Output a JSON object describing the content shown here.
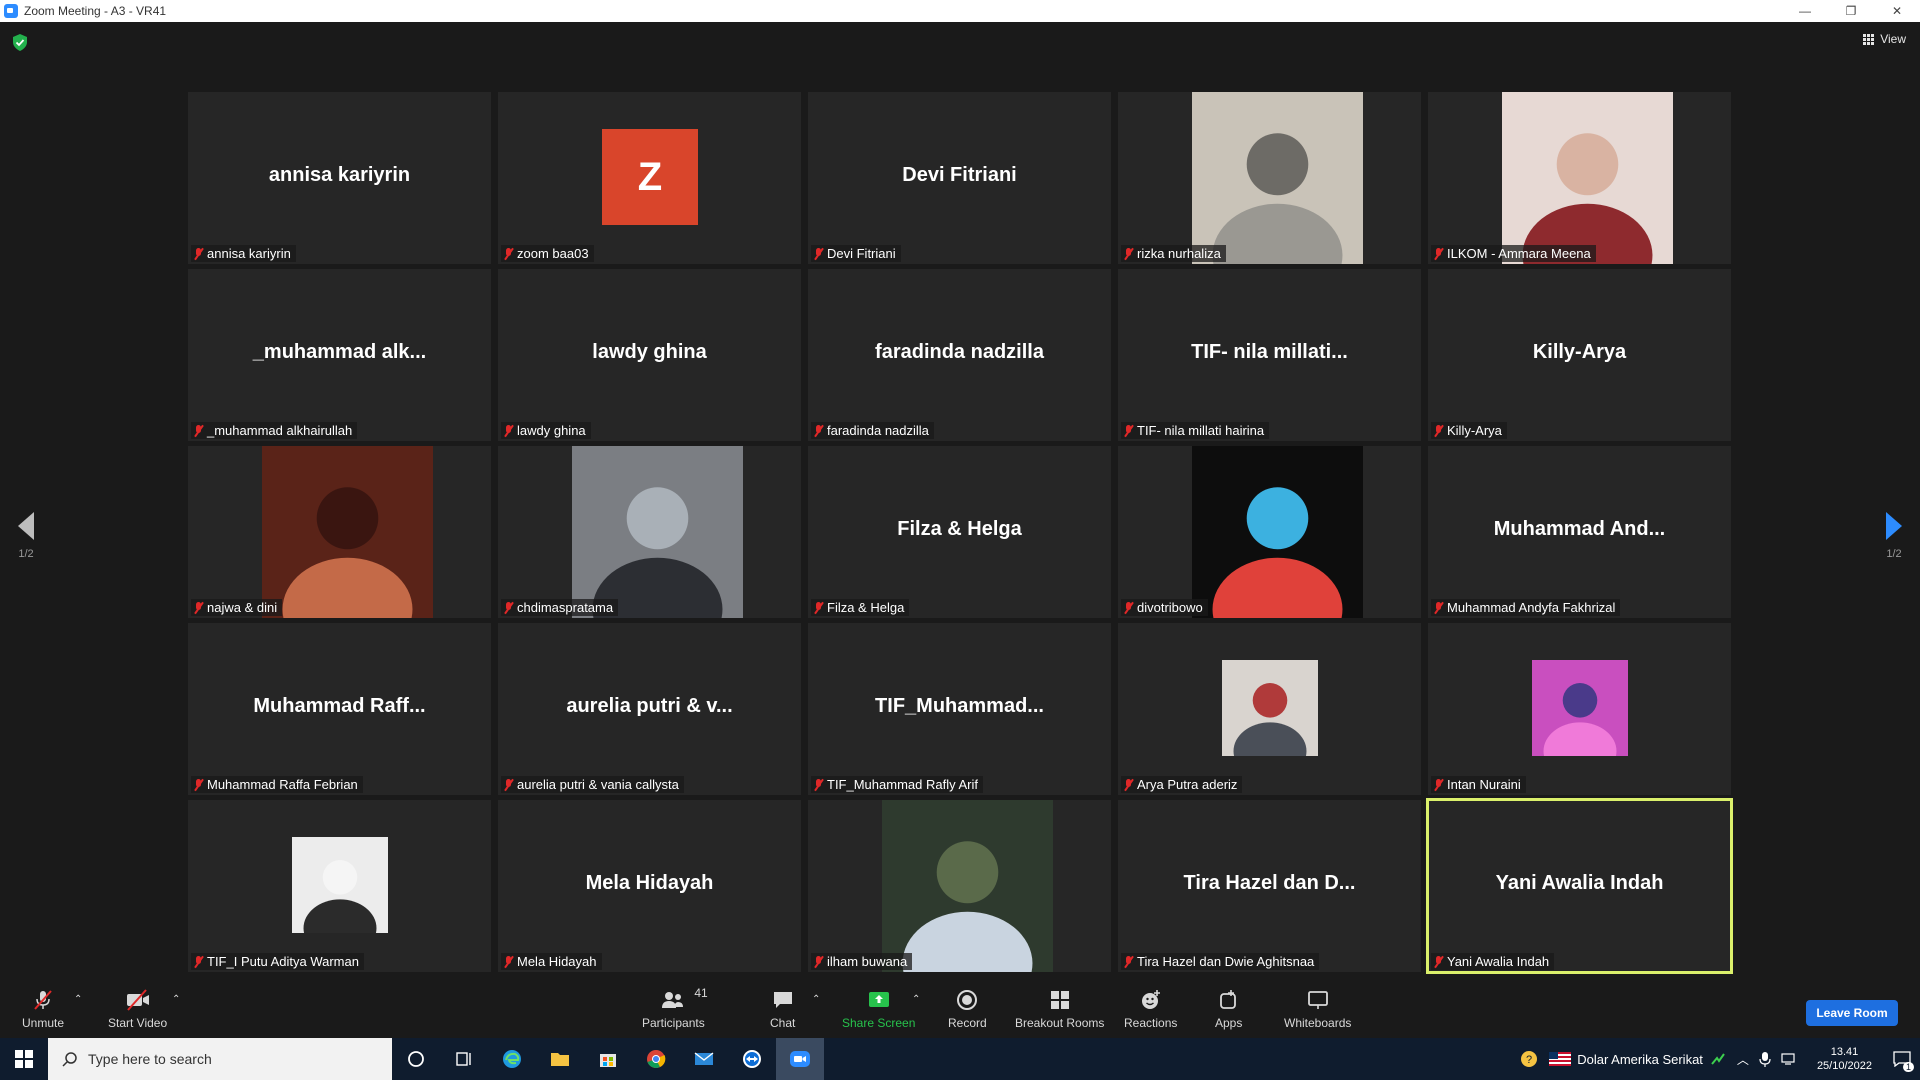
{
  "window": {
    "title": "Zoom Meeting - A3 - VR41",
    "minimize": "—",
    "maximize": "❐",
    "close": "✕"
  },
  "meeting": {
    "view_label": "View",
    "page_indicator_left": "1/2",
    "page_indicator_right": "1/2"
  },
  "participants": [
    {
      "display": "annisa kariyrin",
      "label": "annisa kariyrin",
      "kind": "name"
    },
    {
      "display": "Z",
      "label": "zoom baa03",
      "kind": "avatar"
    },
    {
      "display": "Devi Fitriani",
      "label": "Devi Fitriani",
      "kind": "name"
    },
    {
      "display": "",
      "label": "rizka nurhaliza",
      "kind": "video"
    },
    {
      "display": "",
      "label": "ILKOM - Ammara Meena",
      "kind": "video"
    },
    {
      "display": "_muhammad  alk...",
      "label": "_muhammad alkhairullah",
      "kind": "name"
    },
    {
      "display": "lawdy ghina",
      "label": "lawdy ghina",
      "kind": "name"
    },
    {
      "display": "faradinda nadzilla",
      "label": "faradinda nadzilla",
      "kind": "name"
    },
    {
      "display": "TIF- nila  millati...",
      "label": "TIF- nila millati hairina",
      "kind": "name"
    },
    {
      "display": "Killy-Arya",
      "label": "Killy-Arya",
      "kind": "name"
    },
    {
      "display": "",
      "label": "najwa & dini",
      "kind": "video"
    },
    {
      "display": "",
      "label": "chdimaspratama",
      "kind": "video"
    },
    {
      "display": "Filza & Helga",
      "label": "Filza & Helga",
      "kind": "name"
    },
    {
      "display": "",
      "label": "divotribowo",
      "kind": "video"
    },
    {
      "display": "Muhammad  And...",
      "label": "Muhammad Andyfa Fakhrizal",
      "kind": "name"
    },
    {
      "display": "Muhammad  Raff...",
      "label": "Muhammad Raffa Febrian",
      "kind": "name"
    },
    {
      "display": "aurelia putri & v...",
      "label": "aurelia putri & vania callysta",
      "kind": "name"
    },
    {
      "display": "TIF_Muhammad...",
      "label": "TIF_Muhammad Rafly Arif",
      "kind": "name"
    },
    {
      "display": "",
      "label": "Arya Putra aderiz",
      "kind": "photo"
    },
    {
      "display": "",
      "label": "Intan Nuraini",
      "kind": "photo"
    },
    {
      "display": "",
      "label": "TIF_I Putu Aditya Warman",
      "kind": "photo"
    },
    {
      "display": "Mela Hidayah",
      "label": "Mela Hidayah",
      "kind": "name"
    },
    {
      "display": "",
      "label": "ilham buwana",
      "kind": "video"
    },
    {
      "display": "Tira Hazel dan D...",
      "label": "Tira Hazel dan Dwie Aghitsnaa",
      "kind": "name"
    },
    {
      "display": "Yani Awalia Indah",
      "label": "Yani Awalia Indah",
      "kind": "name",
      "active": true
    }
  ],
  "toolbar": {
    "unmute": "Unmute",
    "start_video": "Start Video",
    "participants": "Participants",
    "participants_count": "41",
    "chat": "Chat",
    "share_screen": "Share Screen",
    "record": "Record",
    "breakout_rooms": "Breakout Rooms",
    "reactions": "Reactions",
    "apps": "Apps",
    "whiteboards": "Whiteboards",
    "leave_room": "Leave Room"
  },
  "taskbar": {
    "search_placeholder": "Type here to search",
    "currency": "Dolar Amerika Serikat",
    "time": "13.41",
    "date": "25/10/2022",
    "notification_count": "1"
  },
  "colors": {
    "active_speaker_border": "#dbf06b",
    "leave_button": "#1e6fe0",
    "share_screen": "#27c24c",
    "muted_mic": "#e02828",
    "avatar_z": "#d9452b"
  }
}
